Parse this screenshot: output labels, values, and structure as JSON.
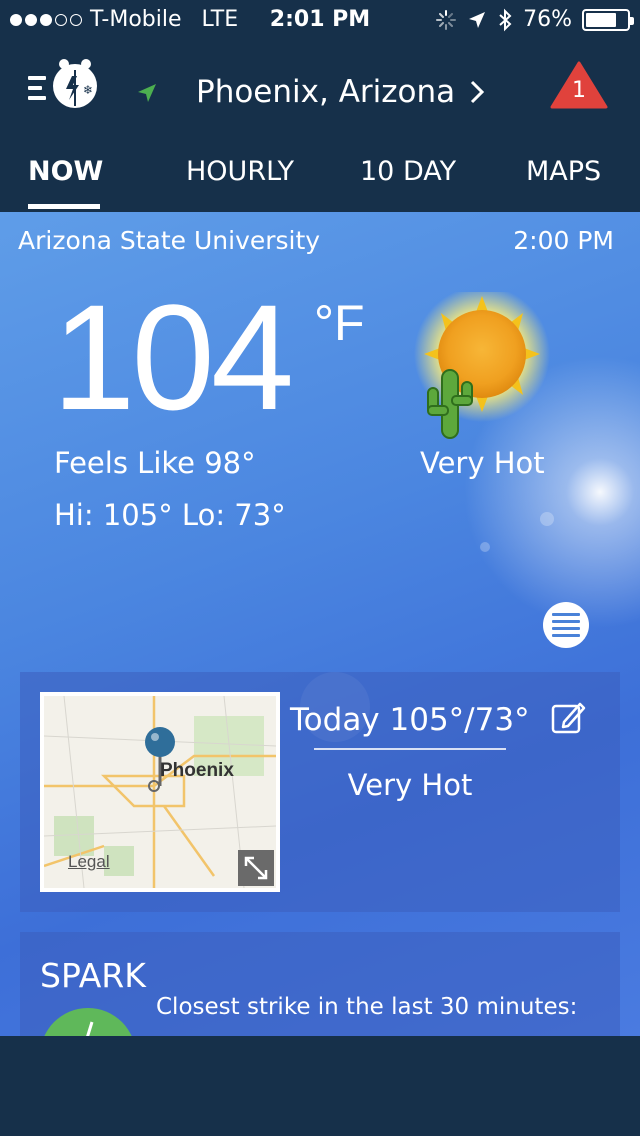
{
  "status_bar": {
    "carrier": "T-Mobile",
    "network": "LTE",
    "time": "2:01 PM",
    "battery": "76%",
    "battery_level": 0.76,
    "signal_bars": 3,
    "signal_max": 5
  },
  "header": {
    "location": "Phoenix,  Arizona",
    "alert_count": "1"
  },
  "tabs": [
    {
      "label": "NOW",
      "active": true
    },
    {
      "label": "HOURLY",
      "active": false
    },
    {
      "label": "10  DAY",
      "active": false
    },
    {
      "label": "MAPS",
      "active": false
    }
  ],
  "current": {
    "station": "Arizona  State  University",
    "time": "2:00  PM",
    "temperature": "104",
    "unit": "°F",
    "feels_like": "Feels  Like  98°",
    "hi_lo": "Hi: 105°  Lo: 73°",
    "condition": "Very  Hot"
  },
  "today_card": {
    "map_label": "Phoenix",
    "legal": "Legal",
    "summary": "Today  105°/73°",
    "condition": "Very  Hot"
  },
  "spark": {
    "title": "SPARK",
    "text": "Closest  strike  in  the  last  30  minutes:"
  },
  "colors": {
    "header_bg": "#16304a",
    "alert_red": "#e0423c",
    "nav_arrow_green": "#4caf50",
    "spark_green": "#5fb85a"
  }
}
